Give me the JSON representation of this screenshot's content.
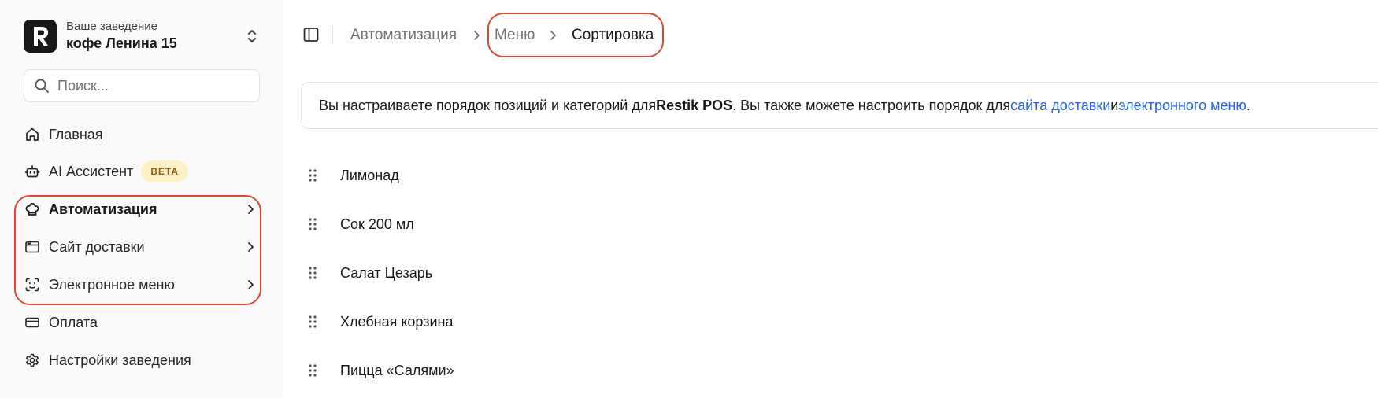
{
  "sidebar": {
    "venue": {
      "subtitle": "Ваше заведение",
      "name": "кофе Ленина 15"
    },
    "search": {
      "placeholder": "Поиск..."
    },
    "items": [
      {
        "label": "Главная",
        "icon": "home-icon"
      },
      {
        "label": "AI Ассистент",
        "icon": "bot-icon",
        "badge": "BETA"
      },
      {
        "label": "Автоматизация",
        "icon": "chef-hat-icon",
        "active": true
      },
      {
        "label": "Сайт доставки",
        "icon": "browser-window-icon"
      },
      {
        "label": "Электронное меню",
        "icon": "scan-face-icon"
      },
      {
        "label": "Оплата",
        "icon": "credit-card-icon"
      },
      {
        "label": "Настройки заведения",
        "icon": "gear-icon"
      }
    ]
  },
  "breadcrumb": [
    "Автоматизация",
    "Меню",
    "Сортировка"
  ],
  "notice": {
    "text_before": "Вы настраиваете порядок позиций и категорий для ",
    "pos_name": "Restik POS",
    "text_middle": ". Вы также можете настроить порядок для ",
    "link_delivery": "сайта доставки",
    "text_and": " и ",
    "link_emenu": "электронного меню",
    "text_end": "."
  },
  "sort_items": [
    {
      "label": "Лимонад"
    },
    {
      "label": "Сок 200 мл"
    },
    {
      "label": "Салат Цезарь"
    },
    {
      "label": "Хлебная корзина"
    },
    {
      "label": "Пицца «Салями»"
    }
  ],
  "colors": {
    "accent_link": "#2563eb",
    "highlight": "#e0492f",
    "badge_bg": "#fdf0c4",
    "badge_text": "#8a5a0a",
    "logo_bg": "#18181b"
  }
}
